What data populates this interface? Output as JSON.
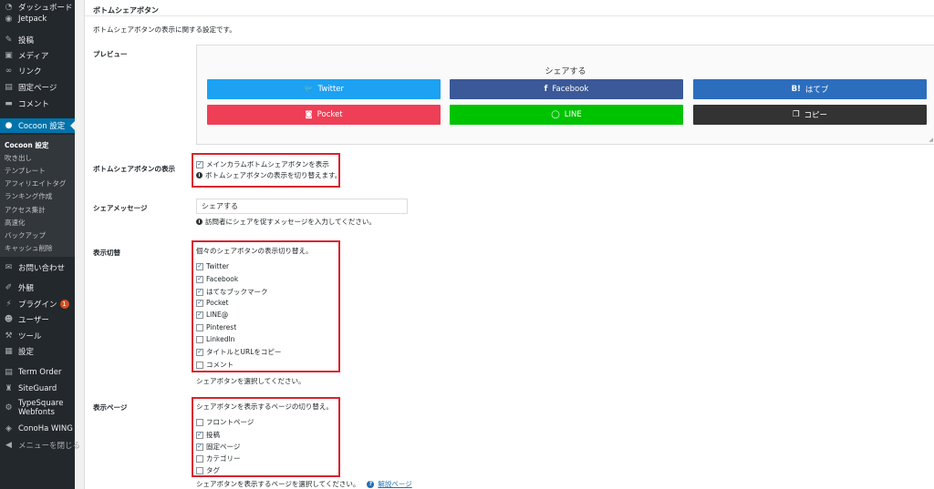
{
  "sidebar": {
    "items": [
      {
        "label": "ダッシュボード",
        "icon": "dashboard-icon",
        "glyph": "◔"
      },
      {
        "label": "Jetpack",
        "icon": "jetpack-icon",
        "glyph": "◉"
      },
      {
        "label": "投稿",
        "icon": "pin-icon",
        "glyph": "✎"
      },
      {
        "label": "メディア",
        "icon": "media-icon",
        "glyph": "▣"
      },
      {
        "label": "リンク",
        "icon": "link-icon",
        "glyph": "∞"
      },
      {
        "label": "固定ページ",
        "icon": "page-icon",
        "glyph": "▤"
      },
      {
        "label": "コメント",
        "icon": "comment-icon",
        "glyph": "▬"
      },
      {
        "label": "Cocoon 設定",
        "icon": "cocoon-icon",
        "glyph": "●"
      },
      {
        "label": "お問い合わせ",
        "icon": "mail-icon",
        "glyph": "✉"
      },
      {
        "label": "外観",
        "icon": "appearance-icon",
        "glyph": "✐"
      },
      {
        "label": "プラグイン",
        "icon": "plugin-icon",
        "glyph": "⚡",
        "badge": "1"
      },
      {
        "label": "ユーザー",
        "icon": "user-icon",
        "glyph": "☻"
      },
      {
        "label": "ツール",
        "icon": "tools-icon",
        "glyph": "⚒"
      },
      {
        "label": "設定",
        "icon": "settings-icon",
        "glyph": "▦"
      },
      {
        "label": "Term Order",
        "icon": "list-icon",
        "glyph": "▤"
      },
      {
        "label": "SiteGuard",
        "icon": "siteguard-icon",
        "glyph": "♜"
      },
      {
        "label": "TypeSquare",
        "label2": "Webfonts",
        "icon": "gear-icon",
        "glyph": "⚙"
      },
      {
        "label": "ConoHa WING",
        "icon": "conoha-icon",
        "glyph": "◈"
      },
      {
        "label": "メニューを閉じる",
        "icon": "collapse-icon",
        "glyph": "◀"
      }
    ],
    "submenu": [
      "Cocoon 設定",
      "吹き出し",
      "テンプレート",
      "アフィリエイトタグ",
      "ランキング作成",
      "アクセス集計",
      "高速化",
      "バックアップ",
      "キャッシュ削除"
    ]
  },
  "main": {
    "section_title": "ボトムシェアボタン",
    "section_desc": "ボトムシェアボタンの表示に関する設定です。",
    "preview": {
      "label": "プレビュー",
      "heading": "シェアする",
      "buttons": [
        {
          "label": "Twitter",
          "icon": "twitter-icon",
          "glyph": "🐦",
          "color": "#1da1f2"
        },
        {
          "label": "Facebook",
          "icon": "facebook-icon",
          "glyph": "f",
          "color": "#3b5998"
        },
        {
          "label": "はてブ",
          "icon": "hatena-icon",
          "glyph": "B!",
          "color": "#2c6ebd"
        },
        {
          "label": "Pocket",
          "icon": "pocket-icon",
          "glyph": "◙",
          "color": "#ef3f56"
        },
        {
          "label": "LINE",
          "icon": "line-icon",
          "glyph": "◯",
          "color": "#00c300"
        },
        {
          "label": "コピー",
          "icon": "copy-icon",
          "glyph": "❐",
          "color": "#333333"
        }
      ]
    },
    "display": {
      "label": "ボトムシェアボタンの表示",
      "checkbox_label": "メインカラムボトムシェアボタンを表示",
      "checked": true,
      "note": "ボトムシェアボタンの表示を切り替えます。"
    },
    "message": {
      "label": "シェアメッセージ",
      "value": "シェアする",
      "note": "訪問者にシェアを促すメッセージを入力してください。"
    },
    "toggle": {
      "label": "表示切替",
      "intro": "個々のシェアボタンの表示切り替え。",
      "items": [
        {
          "label": "Twitter",
          "checked": true
        },
        {
          "label": "Facebook",
          "checked": true
        },
        {
          "label": "はてなブックマーク",
          "checked": true
        },
        {
          "label": "Pocket",
          "checked": true
        },
        {
          "label": "LINE@",
          "checked": true
        },
        {
          "label": "Pinterest",
          "checked": false
        },
        {
          "label": "LinkedIn",
          "checked": false
        },
        {
          "label": "タイトルとURLをコピー",
          "checked": true
        },
        {
          "label": "コメント",
          "checked": false
        }
      ],
      "footer": "シェアボタンを選択してください。"
    },
    "pages": {
      "label": "表示ページ",
      "intro": "シェアボタンを表示するページの切り替え。",
      "items": [
        {
          "label": "フロントページ",
          "checked": false
        },
        {
          "label": "投稿",
          "checked": true
        },
        {
          "label": "固定ページ",
          "checked": true
        },
        {
          "label": "カテゴリー",
          "checked": false
        },
        {
          "label": "タグ",
          "checked": false
        }
      ],
      "footer": "シェアボタンを表示するページを選択してください。",
      "help_label": "解説ページ",
      "help_icon": "help-icon"
    },
    "highlight_color": "#d9232e"
  }
}
